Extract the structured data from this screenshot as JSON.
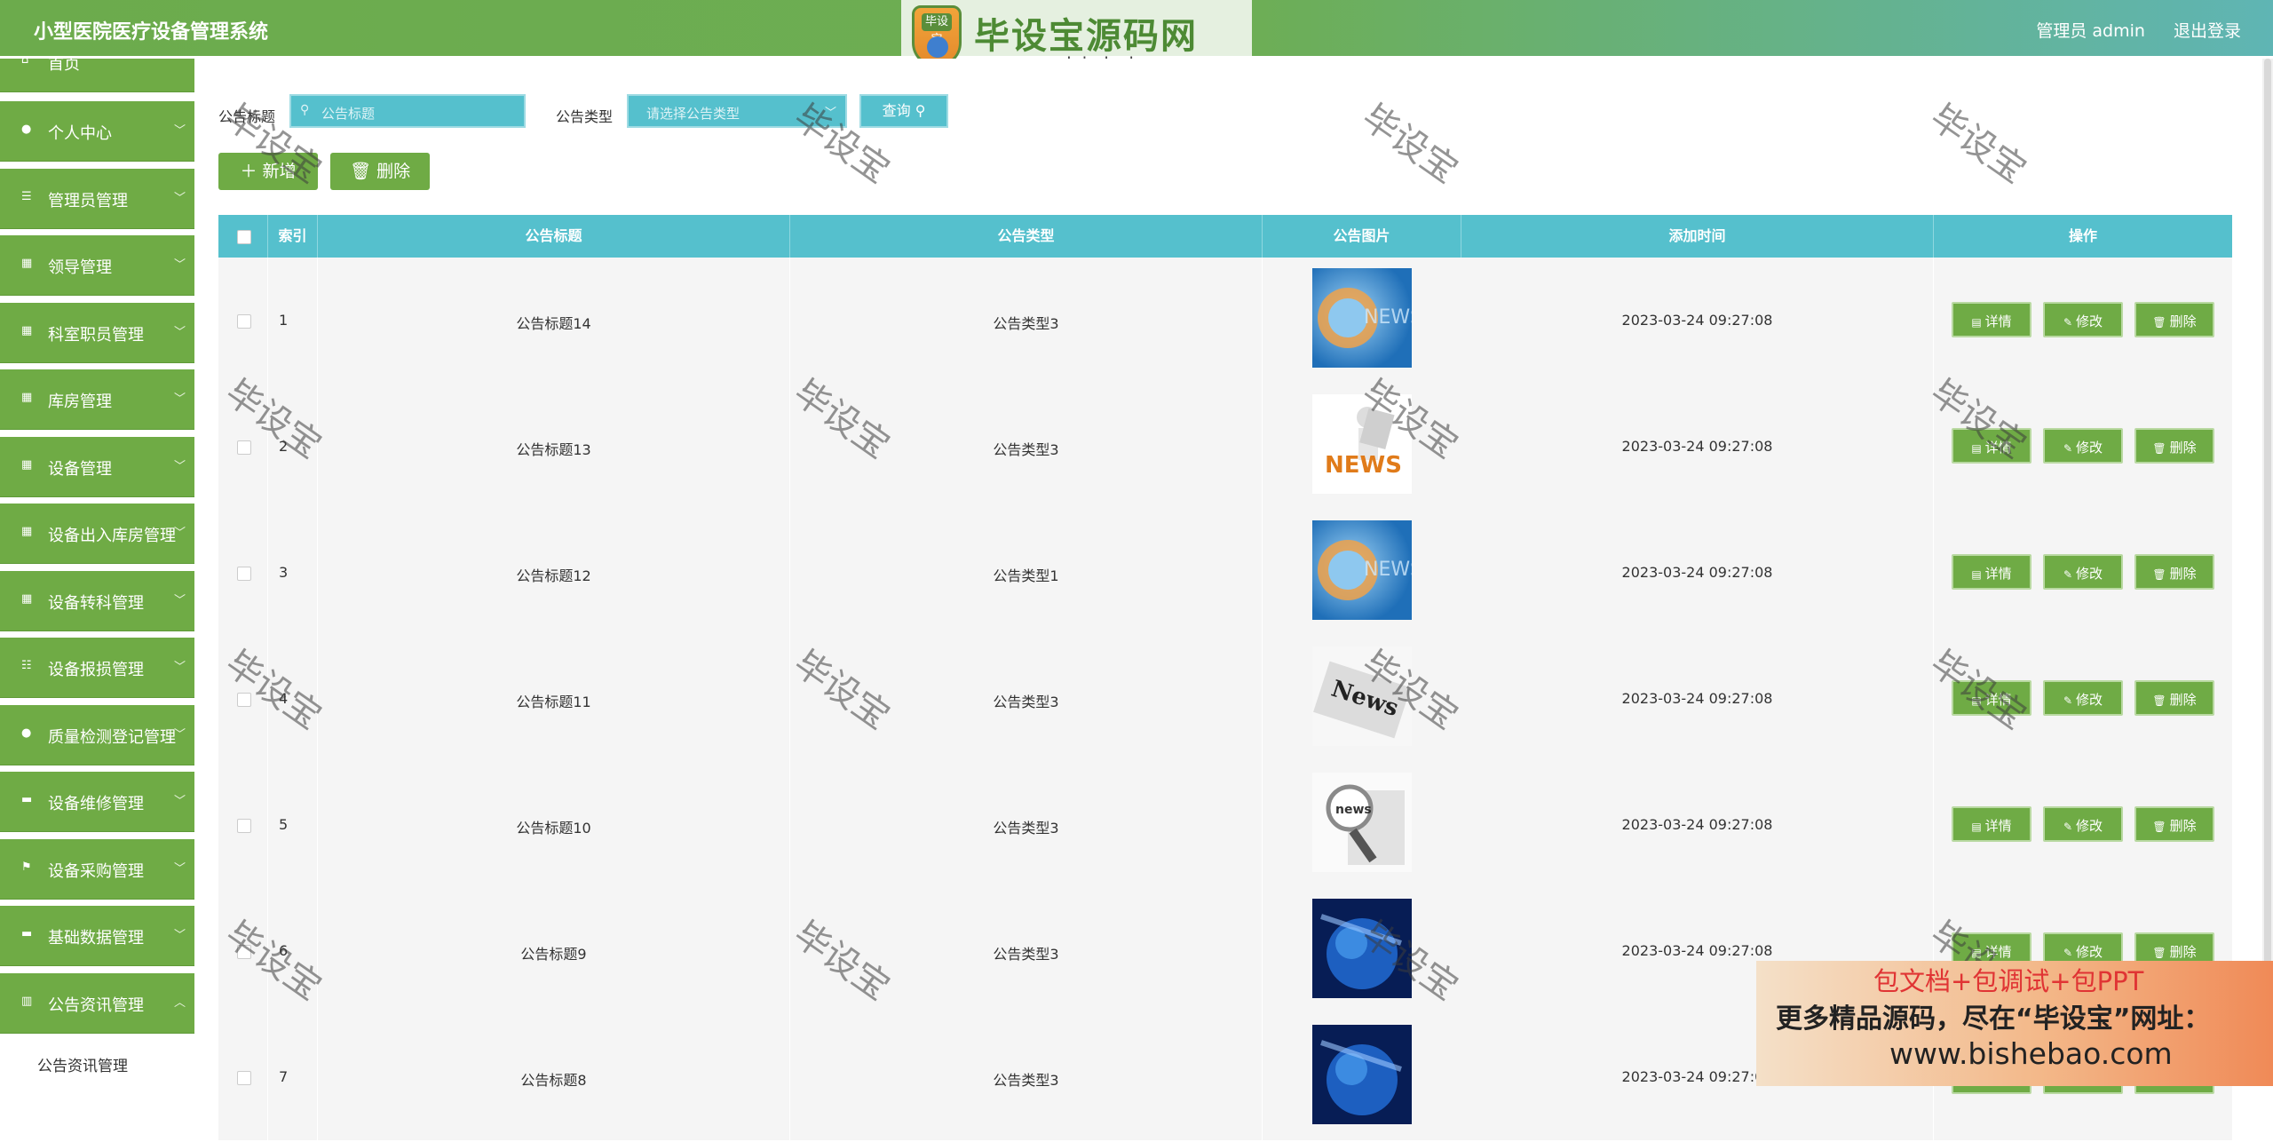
{
  "header": {
    "title": "小型医院医疗设备管理系统",
    "admin_label": "管理员 admin",
    "logout_label": "退出登录"
  },
  "logo": {
    "badge_text": "毕设宝",
    "brand_text": "毕设宝源码网",
    "url_text": "www.bishebao.com"
  },
  "sidebar": {
    "items": [
      {
        "label": "首页",
        "icon": "home-icon"
      },
      {
        "label": "个人中心",
        "icon": "user-icon"
      },
      {
        "label": "管理员管理",
        "icon": "list-icon"
      },
      {
        "label": "领导管理",
        "icon": "grid-icon"
      },
      {
        "label": "科室职员管理",
        "icon": "grid-icon"
      },
      {
        "label": "库房管理",
        "icon": "grid-icon"
      },
      {
        "label": "设备管理",
        "icon": "grid-icon"
      },
      {
        "label": "设备出入库房管理",
        "icon": "grid-icon"
      },
      {
        "label": "设备转科管理",
        "icon": "grid-icon"
      },
      {
        "label": "设备报损管理",
        "icon": "sliders-icon"
      },
      {
        "label": "质量检测登记管理",
        "icon": "bulb-icon"
      },
      {
        "label": "设备维修管理",
        "icon": "monitor-icon"
      },
      {
        "label": "设备采购管理",
        "icon": "flag-icon"
      },
      {
        "label": "基础数据管理",
        "icon": "box-icon"
      },
      {
        "label": "公告资讯管理",
        "icon": "chart-icon"
      }
    ],
    "sub_item": "公告资讯管理"
  },
  "search": {
    "title_label": "公告标题",
    "title_placeholder": "公告标题",
    "type_label": "公告类型",
    "type_placeholder": "请选择公告类型",
    "query_label": "查询"
  },
  "toolbar": {
    "add_label": "新增",
    "delete_label": "删除"
  },
  "table": {
    "headers": [
      "索引",
      "公告标题",
      "公告类型",
      "公告图片",
      "添加时间",
      "操作"
    ],
    "rows": [
      {
        "index": "1",
        "title": "公告标题14",
        "type": "公告类型3",
        "time": "2023-03-24 09:27:08",
        "image": "news-globe"
      },
      {
        "index": "2",
        "title": "公告标题13",
        "type": "公告类型3",
        "time": "2023-03-24 09:27:08",
        "image": "news-figure"
      },
      {
        "index": "3",
        "title": "公告标题12",
        "type": "公告类型1",
        "time": "2023-03-24 09:27:08",
        "image": "news-globe"
      },
      {
        "index": "4",
        "title": "公告标题11",
        "type": "公告类型3",
        "time": "2023-03-24 09:27:08",
        "image": "news-paper"
      },
      {
        "index": "5",
        "title": "公告标题10",
        "type": "公告类型3",
        "time": "2023-03-24 09:27:08",
        "image": "news-magnifier"
      },
      {
        "index": "6",
        "title": "公告标题9",
        "type": "公告类型3",
        "time": "2023-03-24 09:27:08",
        "image": "earth-blue"
      },
      {
        "index": "7",
        "title": "公告标题8",
        "type": "公告类型3",
        "time": "2023-03-24 09:27:08",
        "image": "earth-blue"
      }
    ],
    "actions": {
      "detail": "详情",
      "edit": "修改",
      "delete": "删除"
    }
  },
  "watermark": "毕设宝",
  "promo": {
    "line1": "包文档+包调试+包PPT",
    "line2": "更多精品源码，尽在“毕设宝”网址：",
    "line3": "www.bishebao.com"
  },
  "colors": {
    "header_green": "#6cab4c",
    "header_teal": "#5fb5b4",
    "sidebar_green": "#6fab45",
    "table_header": "#55c0cd",
    "row_bg": "#f5f5f5"
  }
}
